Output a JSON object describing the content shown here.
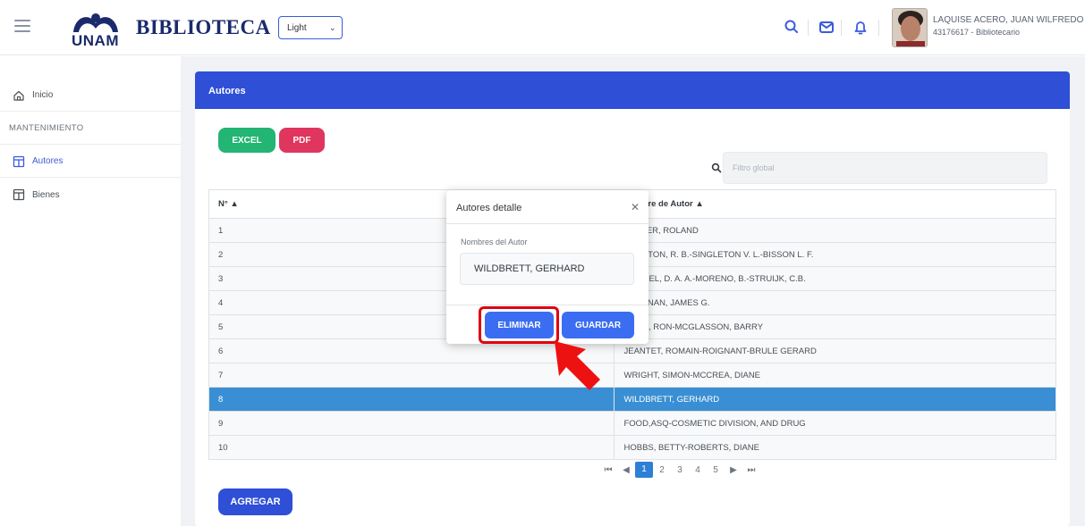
{
  "header": {
    "logo_text": "UNAM",
    "brand": "BIBLIOTECA",
    "theme_selected": "Light",
    "user_name": "LAQUISE ACERO, JUAN WILFREDO",
    "user_role": "43176617 - Bibliotecario"
  },
  "sidebar": {
    "items": [
      {
        "label": "Inicio",
        "icon": "home-icon"
      },
      {
        "label": "MANTENIMIENTO",
        "section": true
      },
      {
        "label": "Autores",
        "icon": "table-icon",
        "active": true
      },
      {
        "label": "Bienes",
        "icon": "table-icon"
      }
    ]
  },
  "card": {
    "title": "Autores",
    "excel_label": "EXCEL",
    "pdf_label": "PDF",
    "filter_placeholder": "Filtro global",
    "add_label": "AGREGAR"
  },
  "table": {
    "columns": [
      "N°",
      "Nombre de Autor"
    ],
    "rows": [
      {
        "n": "1",
        "nombre": "GLASER, ROLAND"
      },
      {
        "n": "2",
        "nombre": "MOULTON, R. B.-SINGLETON V. L.-BISSON L. F."
      },
      {
        "n": "3",
        "nombre": "MOSSEL, D. A. A.-MORENO, B.-STRUIJK, C.B."
      },
      {
        "n": "4",
        "nombre": "BRENNAN, JAMES G."
      },
      {
        "n": "5",
        "nombre": "MILLS, RON-MCGLASSON, BARRY"
      },
      {
        "n": "6",
        "nombre": "JEANTET, ROMAIN-ROIGNANT-BRULE GERARD"
      },
      {
        "n": "7",
        "nombre": "WRIGHT, SIMON-MCCREA, DIANE"
      },
      {
        "n": "8",
        "nombre": "WILDBRETT, GERHARD",
        "selected": true
      },
      {
        "n": "9",
        "nombre": "FOOD,ASQ-COSMETIC DIVISION, AND DRUG"
      },
      {
        "n": "10",
        "nombre": "HOBBS, BETTY-ROBERTS, DIANE"
      }
    ]
  },
  "pagination": {
    "current": 1,
    "pages": [
      "1",
      "2",
      "3",
      "4",
      "5"
    ]
  },
  "modal": {
    "title": "Autores detalle",
    "field_label": "Nombres del Autor",
    "field_value": "WILDBRETT, GERHARD",
    "delete_label": "ELIMINAR",
    "save_label": "GUARDAR"
  },
  "colors": {
    "primary": "#2e4fd6",
    "excel": "#22b573",
    "pdf": "#e0355e",
    "selected_row": "#3a8fd4",
    "highlight": "#e0000f"
  }
}
